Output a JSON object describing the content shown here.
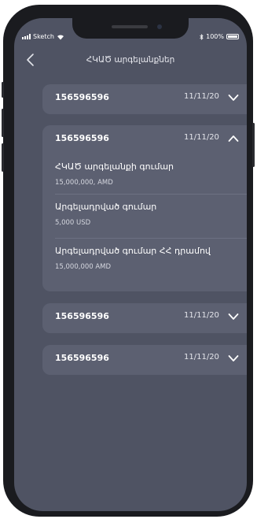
{
  "status_bar": {
    "carrier": "Sketch",
    "battery": "100%"
  },
  "header": {
    "title": "ՀԿԱԾ արգելանքներ"
  },
  "accounts": [
    {
      "number": "156596596",
      "date": "11/11/20",
      "expanded": false
    },
    {
      "number": "156596596",
      "date": "11/11/20",
      "expanded": true,
      "details": [
        {
          "label": "ՀԿԱԾ արգելանքի գումար",
          "value": "15,000,000, AMD"
        },
        {
          "label": "Արգելադրված գումար",
          "value": "5,000 USD"
        },
        {
          "label": "Արգելադրված գումար ՀՀ դրամով",
          "value": "15,000,000 AMD"
        }
      ]
    },
    {
      "number": "156596596",
      "date": "11/11/20",
      "expanded": false
    },
    {
      "number": "156596596",
      "date": "11/11/20",
      "expanded": false
    }
  ],
  "colors": {
    "screen_bg": "#4f5363",
    "card_bg": "#5c6071",
    "text": "#ffffff"
  },
  "icons": {
    "back": "chevron-left-icon",
    "expand": "chevron-down-icon",
    "collapse": "chevron-up-icon"
  }
}
